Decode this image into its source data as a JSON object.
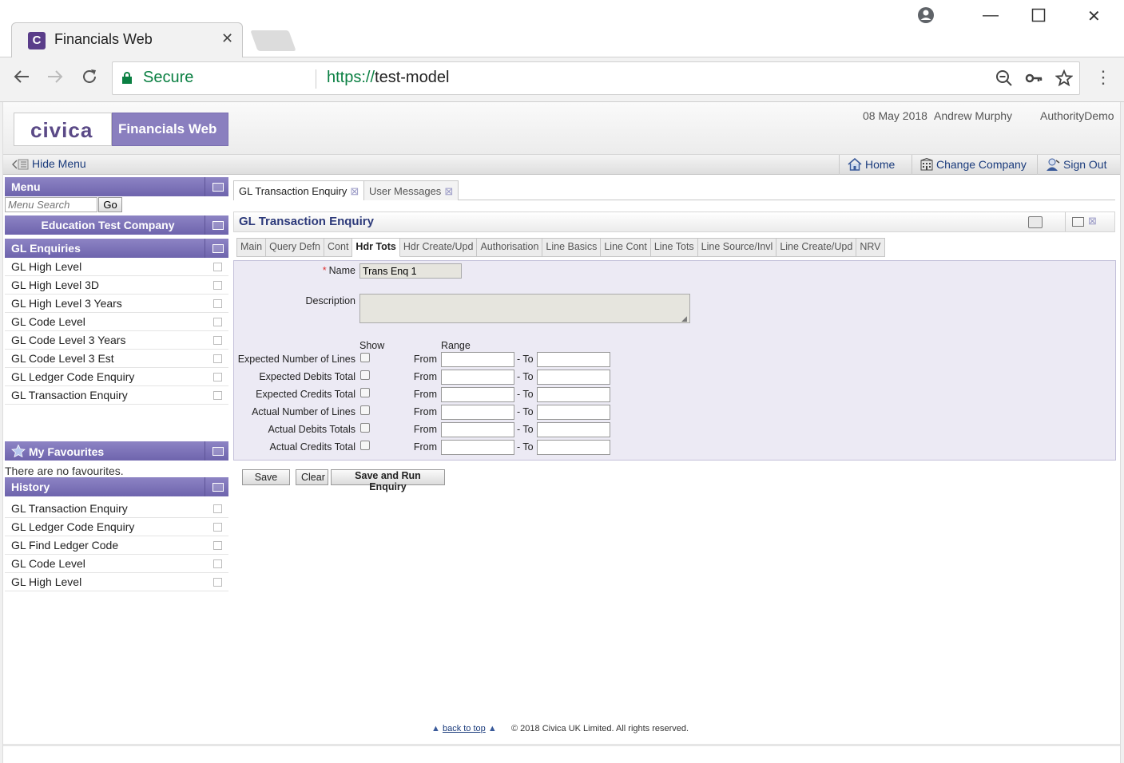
{
  "browser": {
    "tab_title": "Financials Web",
    "tab_favicon_letter": "C",
    "secure_label": "Secure",
    "url_scheme": "https://",
    "url_host": "test-model"
  },
  "header": {
    "logo_text": "civica",
    "app_name": "Financials Web",
    "date": "08 May 2018",
    "user": "Andrew Murphy",
    "authority": "AuthorityDemo"
  },
  "toolbar": {
    "hide_menu": "Hide Menu",
    "home": "Home",
    "change_company": "Change Company",
    "sign_out": "Sign Out"
  },
  "sidebar": {
    "menu_title": "Menu",
    "search_placeholder": "Menu Search",
    "go_label": "Go",
    "company": "Education Test Company",
    "section_title": "GL Enquiries",
    "items": [
      "GL High Level",
      "GL High Level 3D",
      "GL High Level 3 Years",
      "GL Code Level",
      "GL Code Level 3 Years",
      "GL Code Level 3 Est",
      "GL Ledger Code Enquiry",
      "GL Transaction Enquiry"
    ],
    "favourites_title": "My Favourites",
    "no_favourites": "There are no favourites.",
    "history_title": "History",
    "history": [
      "GL Transaction Enquiry",
      "GL Ledger Code Enquiry",
      "GL Find Ledger Code",
      "GL Code Level",
      "GL High Level"
    ]
  },
  "doc_tabs": [
    "GL Transaction Enquiry",
    "User Messages"
  ],
  "panel": {
    "title": "GL Transaction Enquiry",
    "sub_tabs": [
      "Main",
      "Query Defn",
      "Cont",
      "Hdr Tots",
      "Hdr Create/Upd",
      "Authorisation",
      "Line Basics",
      "Line Cont",
      "Line Tots",
      "Line Source/Invl",
      "Line Create/Upd",
      "NRV"
    ],
    "active_sub_tab": "Hdr Tots"
  },
  "form": {
    "name_label": "Name",
    "name_value": "Trans Enq 1",
    "description_label": "Description",
    "show_header": "Show",
    "range_header": "Range",
    "from_label": "From",
    "to_label": "- To",
    "rows": [
      "Expected Number of Lines",
      "Expected Debits Total",
      "Expected Credits Total",
      "Actual Number of Lines",
      "Actual Debits Totals",
      "Actual Credits Total"
    ]
  },
  "buttons": {
    "save": "Save",
    "clear": "Clear",
    "save_run": "Save and Run Enquiry"
  },
  "footer": {
    "back_to_top": "back to top",
    "copyright": "© 2018 Civica UK Limited. All rights reserved."
  },
  "colors": {
    "accent": "#7a70b8",
    "link": "#1a3b7c",
    "secure": "#0b8043"
  }
}
